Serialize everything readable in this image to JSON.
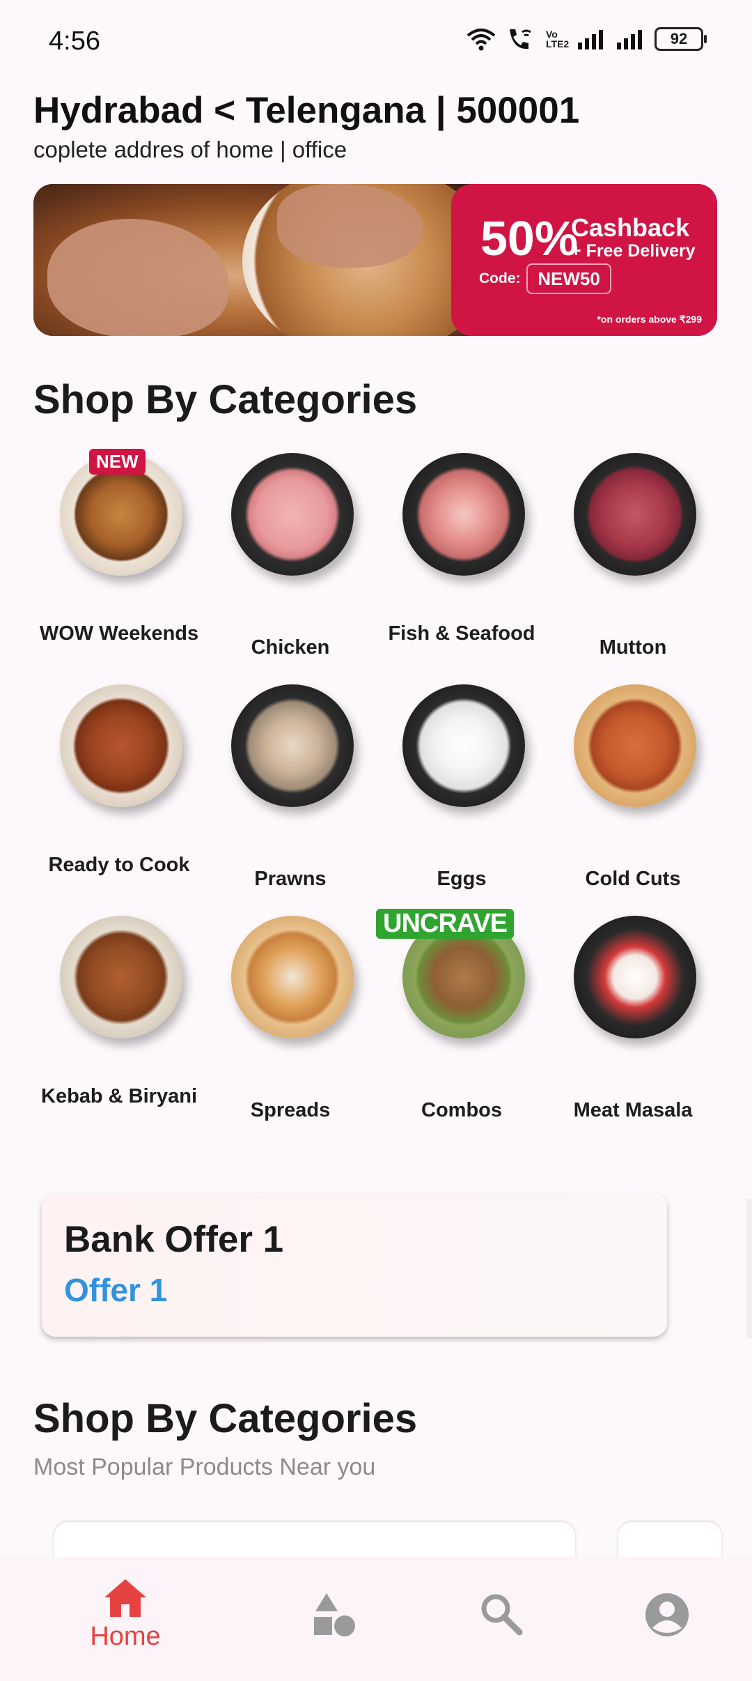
{
  "status_bar": {
    "time": "4:56",
    "battery": "92",
    "volte_label": "Vo LTE2"
  },
  "address": {
    "title": "Hydrabad < Telengana | 500001",
    "subtitle": "coplete addres of home | office"
  },
  "banner": {
    "percent": "50%",
    "cashback": "Cashback",
    "free_delivery": "+ Free Delivery",
    "code_label": "Code:",
    "code": "NEW50",
    "footnote": "*on orders above ₹299",
    "accent_color": "#d01545"
  },
  "categories_section": {
    "title": "Shop By Categories"
  },
  "categories": [
    {
      "label": "WOW Weekends",
      "badge": "NEW"
    },
    {
      "label": "Chicken"
    },
    {
      "label": "Fish & Seafood"
    },
    {
      "label": "Mutton"
    },
    {
      "label": "Ready to Cook"
    },
    {
      "label": "Prawns"
    },
    {
      "label": "Eggs"
    },
    {
      "label": "Cold Cuts"
    },
    {
      "label": "Kebab & Biryani"
    },
    {
      "label": "Spreads"
    },
    {
      "label": "Combos",
      "badge": "UNCRAVE"
    },
    {
      "label": "Meat Masala"
    }
  ],
  "bank_offer": {
    "title": "Bank Offer 1",
    "subtitle": "Offer 1",
    "accent_color": "#2f93e0"
  },
  "popular_section": {
    "title": "Shop By Categories",
    "subtitle": "Most Popular Products Near you"
  },
  "bottom_nav": [
    {
      "icon": "home-icon",
      "label": "Home",
      "active": true
    },
    {
      "icon": "categories-icon"
    },
    {
      "icon": "search-icon"
    },
    {
      "icon": "profile-icon"
    }
  ],
  "colors": {
    "active": "#e64242",
    "inactive": "#9a9a9a"
  }
}
